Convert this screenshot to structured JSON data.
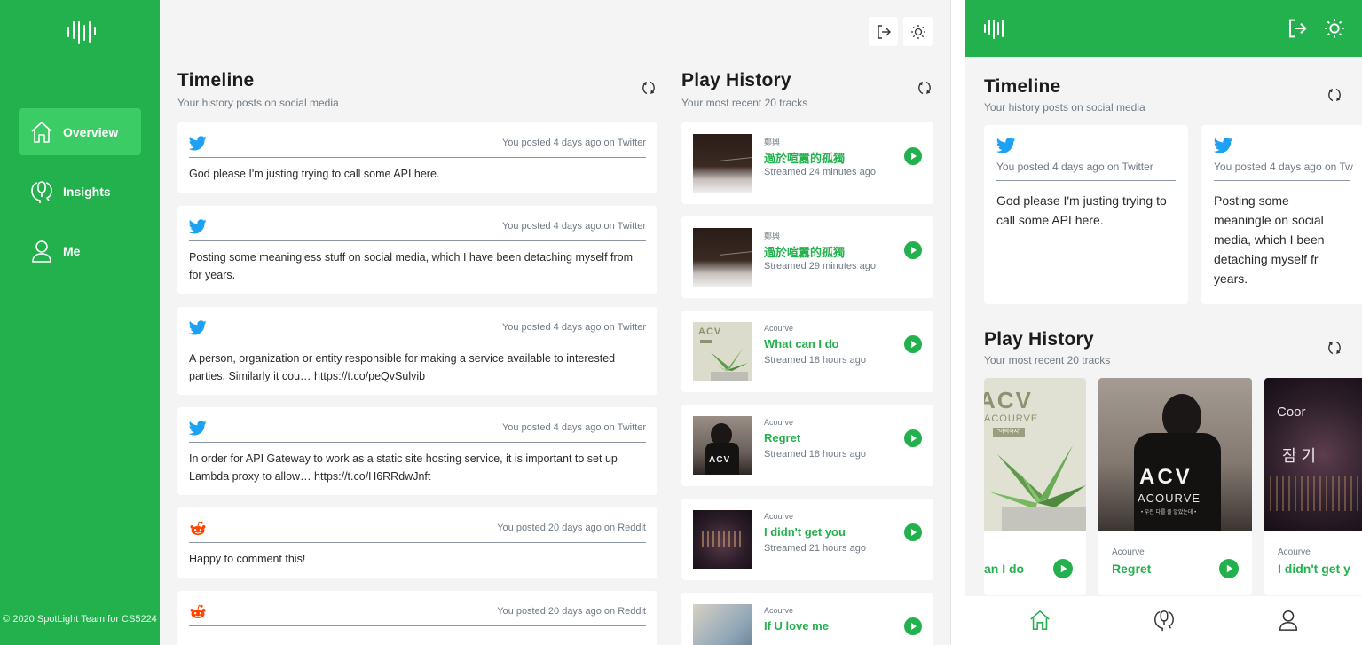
{
  "colors": {
    "brand": "#23b14d",
    "brand_active": "#3ccc66",
    "twitter": "#1da1f2",
    "reddit": "#ff4500"
  },
  "sidebar": {
    "items": [
      {
        "label": "Overview",
        "icon": "home-icon",
        "active": true
      },
      {
        "label": "Insights",
        "icon": "insights-icon",
        "active": false
      },
      {
        "label": "Me",
        "icon": "user-icon",
        "active": false
      }
    ],
    "copyright": "© 2020 SpotLight Team for CS5224"
  },
  "timeline": {
    "title": "Timeline",
    "subtitle": "Your history posts on social media",
    "posts": [
      {
        "platform": "twitter",
        "meta": "You posted 4 days ago on Twitter",
        "text": "God please I'm justing trying to call some API here."
      },
      {
        "platform": "twitter",
        "meta": "You posted 4 days ago on Twitter",
        "text": "Posting some meaningless stuff on social media, which I have been detaching myself from for years."
      },
      {
        "platform": "twitter",
        "meta": "You posted 4 days ago on Twitter",
        "text": "A person, organization or entity responsible for making a service available to interested parties. Similarly it cou… https://t.co/peQvSulvib"
      },
      {
        "platform": "twitter",
        "meta": "You posted 4 days ago on Twitter",
        "text": "In order for API Gateway to work as a static site hosting service, it is important to set up Lambda proxy to allow… https://t.co/H6RRdwJnft"
      },
      {
        "platform": "reddit",
        "meta": "You posted 20 days ago on Reddit",
        "text": "Happy to comment this!"
      },
      {
        "platform": "reddit",
        "meta": "You posted 20 days ago on Reddit",
        "text": ""
      }
    ]
  },
  "play_history": {
    "title": "Play History",
    "subtitle": "Your most recent 20 tracks",
    "tracks": [
      {
        "artist": "鄭興",
        "track": "過於喧囂的孤獨",
        "time": "Streamed 24 minutes ago"
      },
      {
        "artist": "鄭興",
        "track": "過於喧囂的孤獨",
        "time": "Streamed 29 minutes ago"
      },
      {
        "artist": "Acourve",
        "track": "What can I do",
        "time": "Streamed 18 hours ago"
      },
      {
        "artist": "Acourve",
        "track": "Regret",
        "time": "Streamed 18 hours ago"
      },
      {
        "artist": "Acourve",
        "track": "I didn't get you",
        "time": "Streamed 21 hours ago"
      },
      {
        "artist": "Acourve",
        "track": "If U love me",
        "time": ""
      }
    ]
  },
  "mobile": {
    "timeline_title": "Timeline",
    "timeline_subtitle": "Your history posts on social media",
    "posts": [
      {
        "meta": "You posted 4 days ago on Twitter",
        "text": "God please I'm justing trying to call some API here."
      },
      {
        "meta": "You posted 4 days ago on Tw",
        "text": "Posting some meaningle on social media, which I been detaching myself fr years."
      }
    ],
    "history_title": "Play History",
    "history_subtitle": "Your most recent 20 tracks",
    "albums": [
      {
        "artist": "",
        "track": "an I do",
        "art_text": "ACV",
        "art_sub": "ACOURVE"
      },
      {
        "artist": "Acourve",
        "track": "Regret",
        "art_text": "ACV",
        "art_sub": "ACOURVE"
      },
      {
        "artist": "Acourve",
        "track": "I didn't get y",
        "art_text": "Coor",
        "art_sub": ""
      }
    ]
  },
  "album_art": {
    "acv_label": "ACV",
    "acv_caption": "\"어떡하지\"",
    "acourve": "ACOURVE",
    "acourve_tagline": "• 우린 다를 줄 알았는데 •",
    "korean": "잠 기"
  }
}
